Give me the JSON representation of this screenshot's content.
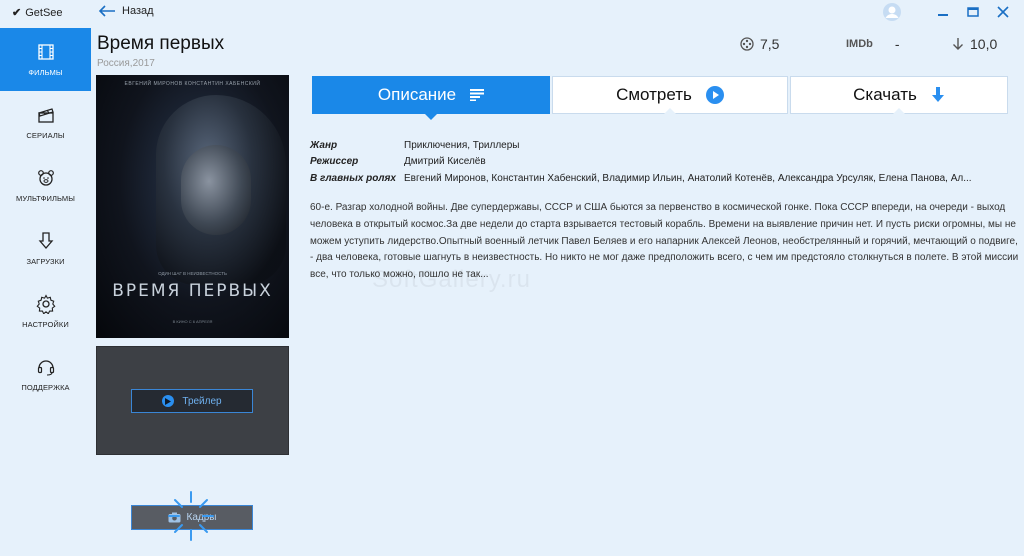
{
  "app": {
    "name": "GetSee"
  },
  "nav": {
    "back_label": "Назад"
  },
  "sidebar": {
    "items": [
      {
        "label": "ФИЛЬМЫ",
        "icon": "film-icon",
        "active": true
      },
      {
        "label": "СЕРИАЛЫ",
        "icon": "clapperboard-icon",
        "active": false
      },
      {
        "label": "МУЛЬТФИЛЬМЫ",
        "icon": "bear-icon",
        "active": false
      },
      {
        "label": "ЗАГРУЗКИ",
        "icon": "download-icon",
        "active": false
      },
      {
        "label": "НАСТРОЙКИ",
        "icon": "gear-icon",
        "active": false
      },
      {
        "label": "ПОДДЕРЖКА",
        "icon": "headset-icon",
        "active": false
      }
    ]
  },
  "movie": {
    "title": "Время первых",
    "subtitle": "Россия,2017",
    "ratings": {
      "kinopoisk": "7,5",
      "imdb_label": "IMDb",
      "imdb": "-",
      "downloads": "10,0"
    },
    "poster": {
      "cast_line": "ЕВГЕНИЙ МИРОНОВ   КОНСТАНТИН ХАБЕНСКИЙ",
      "tagline": "ОДИН ШАГ В НЕИЗВЕСТНОСТЬ",
      "title": "ВРЕМЯ ПЕРВЫХ",
      "footer": "В КИНО С 6 АПРЕЛЯ"
    },
    "trailer_label": "Трейлер",
    "frames_label": "Кадры"
  },
  "tabs": [
    {
      "label": "Описание",
      "icon": "list-icon",
      "active": true
    },
    {
      "label": "Смотреть",
      "icon": "play-icon",
      "active": false
    },
    {
      "label": "Скачать",
      "icon": "download-arrow-icon",
      "active": false
    }
  ],
  "details": {
    "genre_label": "Жанр",
    "genre": "Приключения, Триллеры",
    "director_label": "Режиссер",
    "director": "Дмитрий Киселёв",
    "cast_label": "В главных ролях",
    "cast": "Евгений Миронов, Константин Хабенский, Владимир Ильин, Анатолий Котенёв, Александра Урсуляк, Елена Панова, Ал..."
  },
  "description": "60-е. Разгар холодной войны. Две супердержавы, СССР и США бьются за первенство в космической гонке. Пока СССР впереди, на очереди - выход человека в открытый космос.За две недели до старта взрывается тестовый корабль. Времени на выявление причин нет. И пусть риски огромны, мы не можем уступить лидерство.Опытный военный летчик Павел Беляев и его напарник Алексей Леонов, необстрелянный и горячий, мечтающий о подвиге, - два человека, готовые шагнуть в неизвестность. Но никто не мог даже предположить всего, с чем им предстояло столкнуться в полете. В этой миссии все, что только можно, пошло не так...",
  "watermark": "SoftGallery.ru",
  "colors": {
    "accent": "#1a88e8",
    "background": "#e6f1fb"
  }
}
